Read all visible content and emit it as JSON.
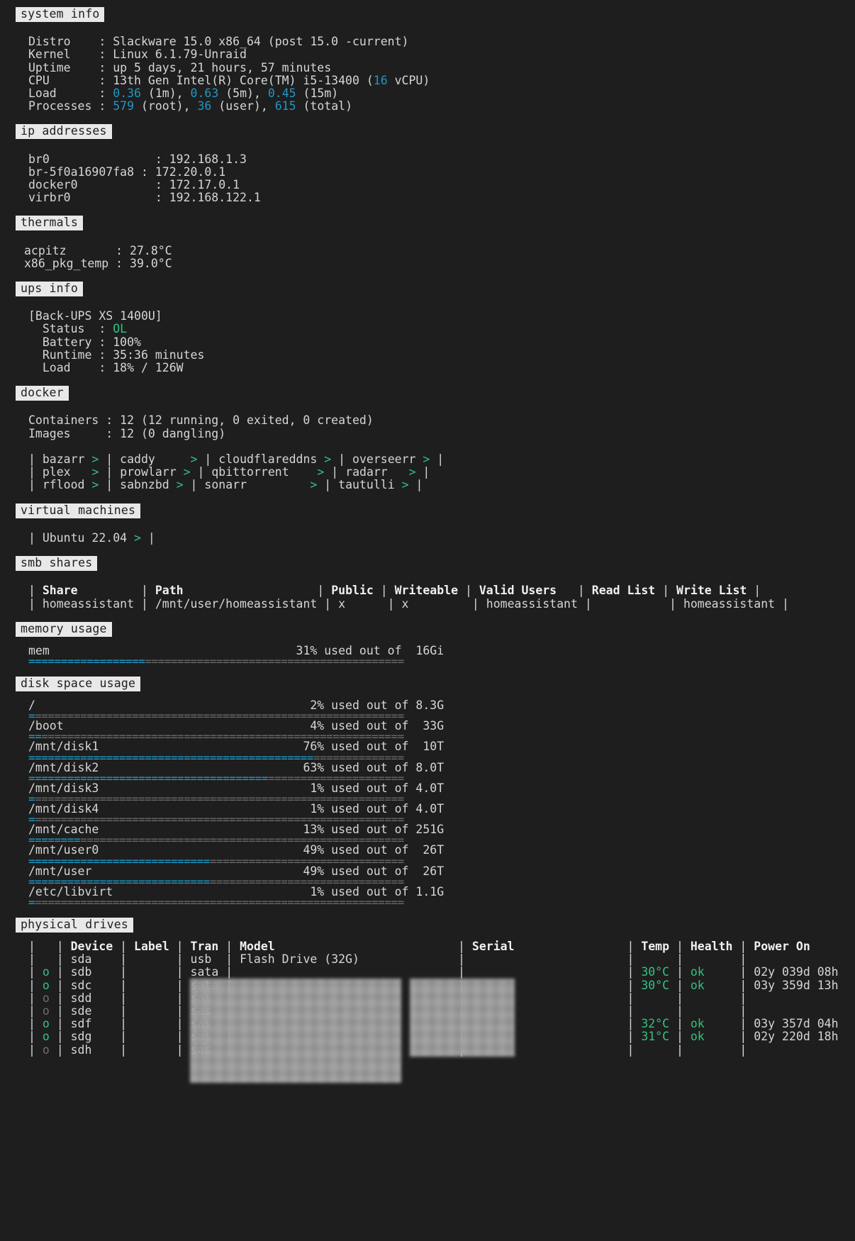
{
  "theme": {
    "bg": "#1e1e1e",
    "fg": "#d6d6d6",
    "accent_cyan": "#2196c4",
    "accent_green": "#33c27f",
    "badge_bg": "#e8e8e8",
    "bar_fill": "#1f9fd0",
    "bar_empty": "#6b6b6b"
  },
  "sections": {
    "system_info": {
      "title": "system info",
      "rows": [
        {
          "label": "Distro",
          "value": "Slackware 15.0 x86_64 (post 15.0 -current)"
        },
        {
          "label": "Kernel",
          "value": "Linux 6.1.79-Unraid"
        },
        {
          "label": "Uptime",
          "value": "up 5 days, 21 hours, 57 minutes"
        }
      ],
      "cpu": {
        "label": "CPU",
        "model": "13th Gen Intel(R) Core(TM) i5-13400",
        "vcpu_count": "16",
        "vcpu_suffix": "vCPU"
      },
      "load": {
        "label": "Load",
        "m1": "0.36",
        "m1_tag": "(1m),",
        "m5": "0.63",
        "m5_tag": "(5m),",
        "m15": "0.45",
        "m15_tag": "(15m)"
      },
      "processes": {
        "label": "Processes",
        "root": "579",
        "root_tag": "(root),",
        "user": "36",
        "user_tag": "(user),",
        "total": "615",
        "total_tag": "(total)"
      }
    },
    "ip_addresses": {
      "title": "ip addresses",
      "rows": [
        {
          "iface": "br0",
          "ip": "192.168.1.3"
        },
        {
          "iface": "br-5f0a16907fa8",
          "ip": "172.20.0.1"
        },
        {
          "iface": "docker0",
          "ip": "172.17.0.1"
        },
        {
          "iface": "virbr0",
          "ip": "192.168.122.1"
        }
      ]
    },
    "thermals": {
      "title": "thermals",
      "rows": [
        {
          "sensor": "acpitz",
          "temp": "27.8°C"
        },
        {
          "sensor": "x86_pkg_temp",
          "temp": "39.0°C"
        }
      ]
    },
    "ups_info": {
      "title": "ups info",
      "device": "[Back-UPS XS 1400U]",
      "status_label": "Status",
      "status_value": "OL",
      "rows": [
        {
          "label": "Battery",
          "value": "100%"
        },
        {
          "label": "Runtime",
          "value": "35:36 minutes"
        },
        {
          "label": "Load",
          "value": "18% / 126W"
        }
      ]
    },
    "docker": {
      "title": "docker",
      "containers_label": "Containers",
      "containers_value": "12 (12 running, 0 exited, 0 created)",
      "images_label": "Images",
      "images_value": "12 (0 dangling)",
      "grid": [
        [
          "bazarr",
          "caddy",
          "cloudflareddns",
          "overseerr"
        ],
        [
          "plex",
          "prowlarr",
          "qbittorrent",
          "radarr"
        ],
        [
          "rflood",
          "sabnzbd",
          "sonarr",
          "tautulli"
        ]
      ],
      "link_marker": ">"
    },
    "virtual_machines": {
      "title": "virtual machines",
      "items": [
        "Ubuntu 22.04"
      ],
      "link_marker": ">"
    },
    "smb_shares": {
      "title": "smb shares",
      "columns": [
        "Share",
        "Path",
        "Public",
        "Writeable",
        "Valid Users",
        "Read List",
        "Write List"
      ],
      "rows": [
        {
          "Share": "homeassistant",
          "Path": "/mnt/user/homeassistant",
          "Public": "x",
          "Writeable": "x",
          "Valid Users": "homeassistant",
          "Read List": "",
          "Write List": "homeassistant"
        }
      ]
    },
    "memory_usage": {
      "title": "memory usage",
      "rows": [
        {
          "name": "mem",
          "percent": 31,
          "percent_label": "31% used out of",
          "size": " 16Gi"
        }
      ]
    },
    "disk_space_usage": {
      "title": "disk space usage",
      "rows": [
        {
          "name": "/",
          "percent": 2,
          "percent_label": "2% used out of",
          "size": "8.3G"
        },
        {
          "name": "/boot",
          "percent": 4,
          "percent_label": "4% used out of",
          "size": " 33G"
        },
        {
          "name": "/mnt/disk1",
          "percent": 76,
          "percent_label": "76% used out of",
          "size": " 10T"
        },
        {
          "name": "/mnt/disk2",
          "percent": 63,
          "percent_label": "63% used out of",
          "size": "8.0T"
        },
        {
          "name": "/mnt/disk3",
          "percent": 1,
          "percent_label": "1% used out of",
          "size": "4.0T"
        },
        {
          "name": "/mnt/disk4",
          "percent": 1,
          "percent_label": "1% used out of",
          "size": "4.0T"
        },
        {
          "name": "/mnt/cache",
          "percent": 13,
          "percent_label": "13% used out of",
          "size": "251G"
        },
        {
          "name": "/mnt/user0",
          "percent": 49,
          "percent_label": "49% used out of",
          "size": " 26T"
        },
        {
          "name": "/mnt/user",
          "percent": 49,
          "percent_label": "49% used out of",
          "size": " 26T"
        },
        {
          "name": "/etc/libvirt",
          "percent": 1,
          "percent_label": "1% used out of",
          "size": "1.1G"
        }
      ]
    },
    "physical_drives": {
      "title": "physical drives",
      "columns": [
        "",
        "",
        "Device",
        "Label",
        "Tran",
        "Model",
        "",
        "Serial",
        "",
        "Temp",
        "Health",
        "Power On",
        ""
      ],
      "header_cells": {
        "device": "Device",
        "label": "Label",
        "tran": "Tran",
        "model": "Model",
        "serial": "Serial",
        "temp": "Temp",
        "health": "Health",
        "power_on": "Power On"
      },
      "rows": [
        {
          "active": "",
          "active_state": "none",
          "device": "sda",
          "label": "",
          "tran": "usb",
          "model": "Flash Drive (32G)",
          "model_redacted": false,
          "serial": "",
          "serial_redacted": false,
          "temp": "",
          "health": "",
          "power_on": ""
        },
        {
          "active": "o",
          "active_state": "on",
          "device": "sdb",
          "label": "",
          "tran": "sata",
          "model": "",
          "model_redacted": true,
          "serial": "",
          "serial_redacted": true,
          "temp": "30°C",
          "health": "ok",
          "power_on": "02y 039d 08h"
        },
        {
          "active": "o",
          "active_state": "on",
          "device": "sdc",
          "label": "",
          "tran": "sata",
          "model": "",
          "model_redacted": true,
          "serial": "",
          "serial_redacted": true,
          "temp": "30°C",
          "health": "ok",
          "power_on": "03y 359d 13h"
        },
        {
          "active": "o",
          "active_state": "off",
          "device": "sdd",
          "label": "",
          "tran": "sas",
          "model": "",
          "model_redacted": true,
          "serial": "",
          "serial_redacted": true,
          "temp": "",
          "health": "",
          "power_on": ""
        },
        {
          "active": "o",
          "active_state": "off",
          "device": "sde",
          "label": "",
          "tran": "sas",
          "model": "",
          "model_redacted": true,
          "serial": "",
          "serial_redacted": true,
          "temp": "",
          "health": "",
          "power_on": ""
        },
        {
          "active": "o",
          "active_state": "on",
          "device": "sdf",
          "label": "",
          "tran": "sas",
          "model": "",
          "model_redacted": true,
          "serial": "",
          "serial_redacted": true,
          "temp": "32°C",
          "health": "ok",
          "power_on": "03y 357d 04h"
        },
        {
          "active": "o",
          "active_state": "on",
          "device": "sdg",
          "label": "",
          "tran": "sas",
          "model": "",
          "model_redacted": true,
          "serial": "",
          "serial_redacted": true,
          "temp": "31°C",
          "health": "ok",
          "power_on": "02y 220d 18h"
        },
        {
          "active": "o",
          "active_state": "off",
          "device": "sdh",
          "label": "",
          "tran": "sas",
          "model": "",
          "model_redacted": true,
          "serial": "",
          "serial_redacted": true,
          "temp": "",
          "health": "",
          "power_on": ""
        }
      ]
    }
  }
}
